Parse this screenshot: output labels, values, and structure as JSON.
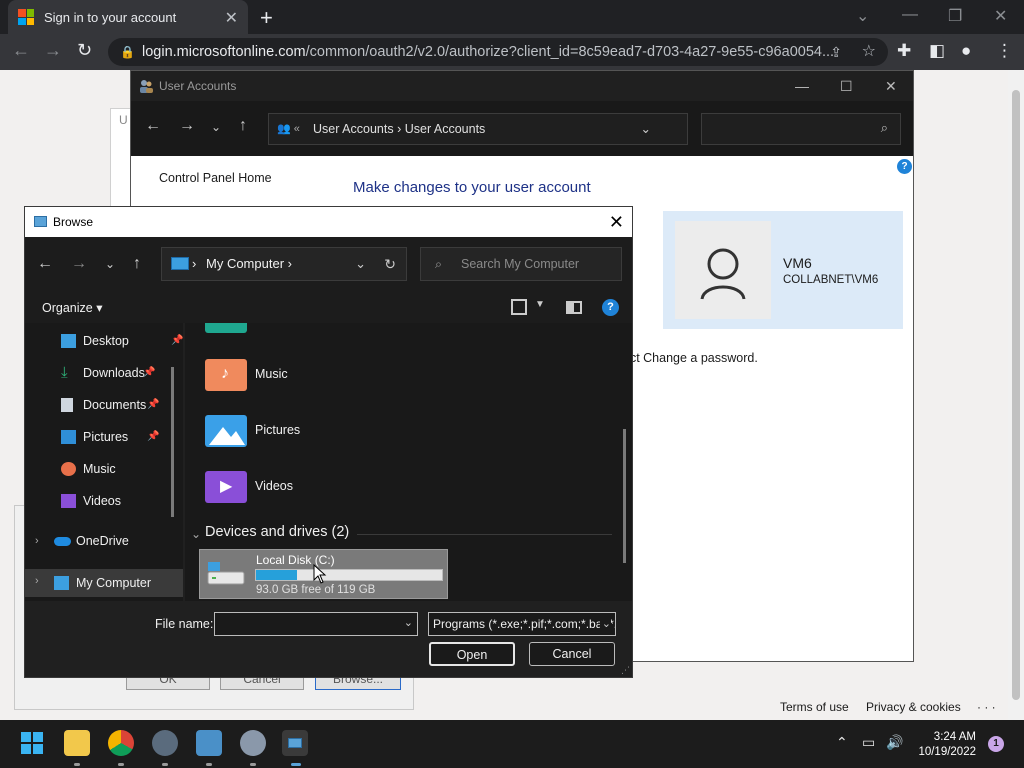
{
  "browser": {
    "tab_title": "Sign in to your account",
    "url_host": "login.microsoftonline.com",
    "url_path": "/common/oauth2/v2.0/authorize?client_id=8c59ead7-d703-4a27-9e55-c96a0054..."
  },
  "page": {
    "footer_terms": "Terms of use",
    "footer_privacy": "Privacy & cookies",
    "footer_more": "· · ·",
    "bg_buttons": [
      "OK",
      "Cancel",
      "Browse..."
    ],
    "bg_tab_char": "U"
  },
  "user_accounts": {
    "title": "User Accounts",
    "breadcrumb": [
      "User Accounts",
      "User Accounts"
    ],
    "control_panel_home": "Control Panel Home",
    "heading": "Make changes to your user account",
    "user_name": "VM6",
    "user_domain": "COLLABNET\\VM6",
    "password_text": "ect Change a password."
  },
  "browse": {
    "title": "Browse",
    "address": "My Computer",
    "search_placeholder": "Search My Computer",
    "organize": "Organize",
    "sidebar": [
      {
        "label": "Desktop",
        "pinned": true
      },
      {
        "label": "Downloads",
        "pinned": true
      },
      {
        "label": "Documents",
        "pinned": true
      },
      {
        "label": "Pictures",
        "pinned": true
      },
      {
        "label": "Music",
        "pinned": false
      },
      {
        "label": "Videos",
        "pinned": false
      },
      {
        "label": "OneDrive",
        "pinned": false
      },
      {
        "label": "My Computer",
        "pinned": false
      }
    ],
    "folders": [
      "Music",
      "Pictures",
      "Videos"
    ],
    "devices_heading": "Devices and drives (2)",
    "disk": {
      "name": "Local Disk (C:)",
      "free_text": "93.0 GB free of 119 GB",
      "used_fraction": 0.22
    },
    "file_name_label": "File name:",
    "file_name_value": "",
    "file_type": "Programs (*.exe;*.pif;*.com;*.bat;*.cmd)",
    "open_label": "Open",
    "cancel_label": "Cancel"
  },
  "taskbar": {
    "time": "3:24 AM",
    "date": "10/19/2022",
    "notification_count": "1"
  }
}
